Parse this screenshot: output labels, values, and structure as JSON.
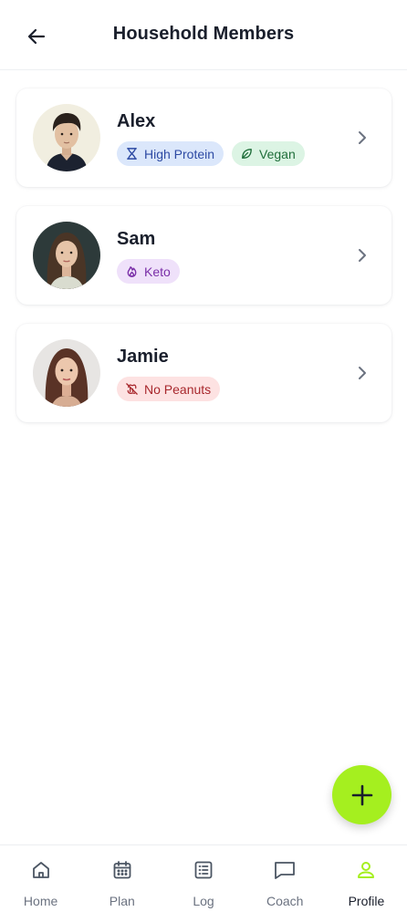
{
  "header": {
    "title": "Household Members"
  },
  "members": [
    {
      "name": "Alex",
      "tags": [
        {
          "label": "High Protein",
          "icon": "dumbbell-icon",
          "color": "#2d4aa3"
        },
        {
          "label": "Vegan",
          "icon": "leaf-icon",
          "color": "#1f6e3a"
        }
      ]
    },
    {
      "name": "Sam",
      "tags": [
        {
          "label": "Keto",
          "icon": "flame-icon",
          "color": "#7a2fa8"
        }
      ]
    },
    {
      "name": "Jamie",
      "tags": [
        {
          "label": "No Peanuts",
          "icon": "no-peanut-icon",
          "color": "#a8282d"
        }
      ]
    }
  ],
  "tabs": [
    {
      "label": "Home",
      "icon": "home-icon"
    },
    {
      "label": "Plan",
      "icon": "calendar-icon"
    },
    {
      "label": "Log",
      "icon": "list-icon"
    },
    {
      "label": "Coach",
      "icon": "chat-icon"
    },
    {
      "label": "Profile",
      "icon": "user-icon",
      "active": true
    }
  ],
  "colors": {
    "accent": "#a5ef1f",
    "active_tab_icon": "#a5ef1f"
  }
}
